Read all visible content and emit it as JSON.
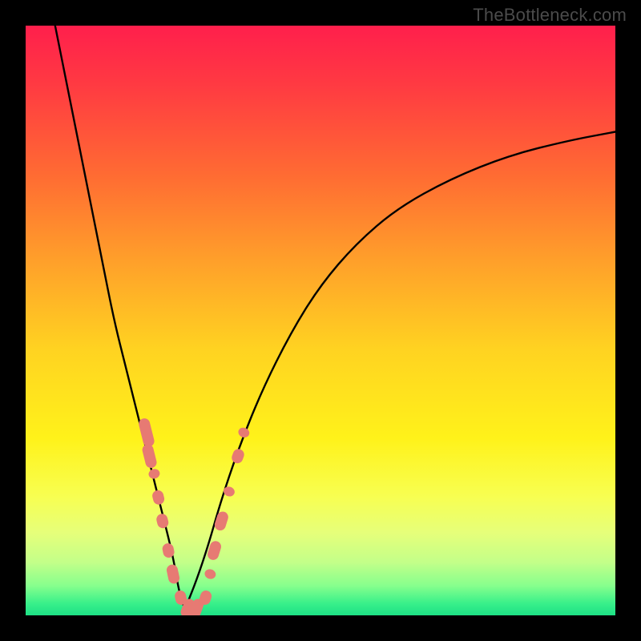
{
  "watermark": "TheBottleneck.com",
  "colors": {
    "frame_bg": "#000000",
    "curve_stroke": "#000000",
    "dot_fill": "#e77a73",
    "gradient_stops": [
      {
        "offset": 0.0,
        "color": "#ff1f4c"
      },
      {
        "offset": 0.1,
        "color": "#ff3a42"
      },
      {
        "offset": 0.25,
        "color": "#ff6a33"
      },
      {
        "offset": 0.4,
        "color": "#ffa02a"
      },
      {
        "offset": 0.55,
        "color": "#ffd321"
      },
      {
        "offset": 0.7,
        "color": "#fff21a"
      },
      {
        "offset": 0.8,
        "color": "#f7ff52"
      },
      {
        "offset": 0.86,
        "color": "#e6ff7a"
      },
      {
        "offset": 0.91,
        "color": "#c3ff89"
      },
      {
        "offset": 0.95,
        "color": "#86ff8d"
      },
      {
        "offset": 0.98,
        "color": "#38f08a"
      },
      {
        "offset": 1.0,
        "color": "#1de085"
      }
    ]
  },
  "chart_data": {
    "type": "line",
    "title": "",
    "xlabel": "",
    "ylabel": "",
    "xlim": [
      0,
      100
    ],
    "ylim": [
      0,
      100
    ],
    "note": "V-shaped bottleneck curve; x is an arbitrary parameter axis (0–100), y is bottleneck magnitude (0–100). Minimum near x≈27.",
    "series": [
      {
        "name": "left-branch",
        "x": [
          5,
          7,
          9,
          11,
          13,
          15,
          17,
          19,
          21,
          23,
          25,
          26,
          27
        ],
        "y": [
          100,
          90,
          80,
          70,
          60,
          50,
          42,
          34,
          26,
          18,
          10,
          4,
          1
        ]
      },
      {
        "name": "right-branch",
        "x": [
          27,
          29,
          31,
          33,
          36,
          40,
          45,
          50,
          56,
          63,
          72,
          82,
          92,
          100
        ],
        "y": [
          1,
          6,
          12,
          19,
          28,
          38,
          48,
          56,
          63,
          69,
          74,
          78,
          80.5,
          82
        ]
      }
    ],
    "dots": {
      "name": "highlighted-points",
      "note": "Salmon capsule-shaped markers clustered near the valley on both branches.",
      "points": [
        {
          "x": 20.5,
          "y": 31,
          "len": 6
        },
        {
          "x": 21.0,
          "y": 27,
          "len": 5
        },
        {
          "x": 21.8,
          "y": 24,
          "len": 2
        },
        {
          "x": 22.5,
          "y": 20,
          "len": 3
        },
        {
          "x": 23.2,
          "y": 16,
          "len": 3
        },
        {
          "x": 24.2,
          "y": 11,
          "len": 3
        },
        {
          "x": 25.0,
          "y": 7,
          "len": 4
        },
        {
          "x": 26.3,
          "y": 3,
          "len": 3
        },
        {
          "x": 27.5,
          "y": 1.2,
          "len": 4
        },
        {
          "x": 29.0,
          "y": 1.2,
          "len": 4
        },
        {
          "x": 30.5,
          "y": 3,
          "len": 3
        },
        {
          "x": 31.3,
          "y": 7,
          "len": 2
        },
        {
          "x": 32.0,
          "y": 11,
          "len": 4
        },
        {
          "x": 33.2,
          "y": 16,
          "len": 4
        },
        {
          "x": 34.5,
          "y": 21,
          "len": 2
        },
        {
          "x": 36.0,
          "y": 27,
          "len": 3
        },
        {
          "x": 37.0,
          "y": 31,
          "len": 2
        }
      ]
    }
  }
}
